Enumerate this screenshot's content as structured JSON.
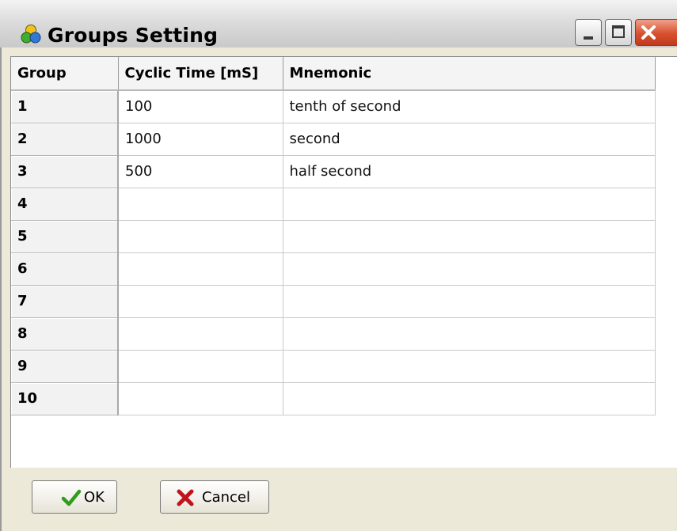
{
  "window": {
    "title": "Groups Setting",
    "app_icon": "groups-icon",
    "buttons": [
      "minimize-icon",
      "maximize-icon",
      "close-icon"
    ]
  },
  "grid": {
    "headers": [
      "Group",
      "Cyclic Time [mS]",
      "Mnemonic"
    ],
    "rows": [
      {
        "group": "1",
        "cyclic_time": "100",
        "mnemonic": "tenth of second"
      },
      {
        "group": "2",
        "cyclic_time": "1000",
        "mnemonic": "second"
      },
      {
        "group": "3",
        "cyclic_time": "500",
        "mnemonic": "half second"
      },
      {
        "group": "4",
        "cyclic_time": "",
        "mnemonic": ""
      },
      {
        "group": "5",
        "cyclic_time": "",
        "mnemonic": ""
      },
      {
        "group": "6",
        "cyclic_time": "",
        "mnemonic": ""
      },
      {
        "group": "7",
        "cyclic_time": "",
        "mnemonic": ""
      },
      {
        "group": "8",
        "cyclic_time": "",
        "mnemonic": ""
      },
      {
        "group": "9",
        "cyclic_time": "",
        "mnemonic": ""
      },
      {
        "group": "10",
        "cyclic_time": "",
        "mnemonic": ""
      }
    ]
  },
  "actions": {
    "ok_label": "OK",
    "ok_icon": "checkmark-icon",
    "cancel_label": "Cancel",
    "cancel_icon": "x-cross-icon"
  },
  "colors": {
    "close_button": "#d8502f",
    "ok_check": "#2e9e1a",
    "cancel_x": "#c0141c",
    "dialog_background": "#ece9d8"
  }
}
